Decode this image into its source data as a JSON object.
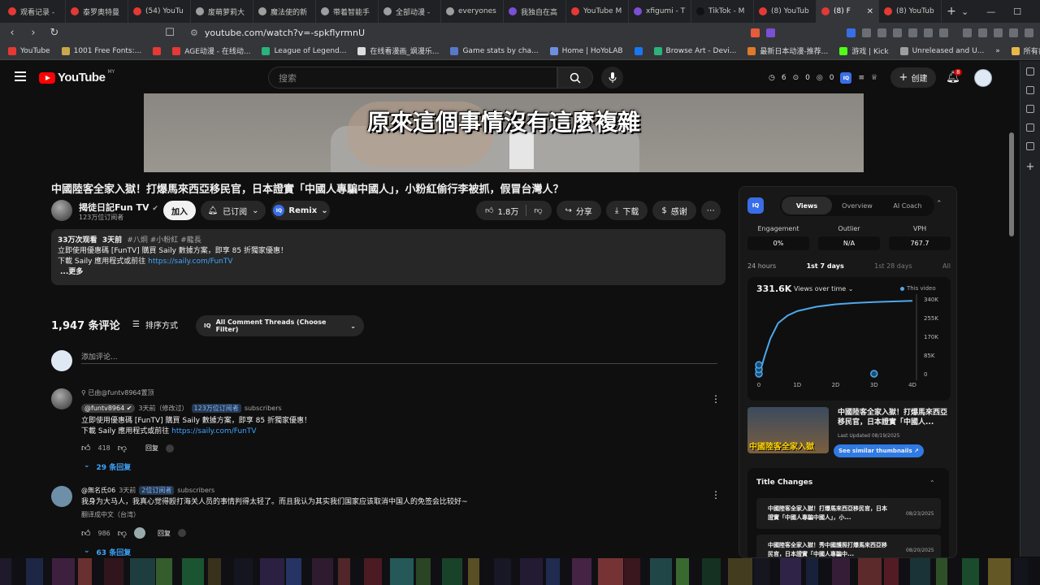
{
  "browser": {
    "tabs": [
      {
        "label": "观看记录 -",
        "color": "#e53935"
      },
      {
        "label": "泰罗奥特曼",
        "color": "#e53935"
      },
      {
        "label": "(54) YouTu",
        "color": "#e53935"
      },
      {
        "label": "废萌萝莉大",
        "color": "#9e9e9e"
      },
      {
        "label": "魔法使的新",
        "color": "#9e9e9e"
      },
      {
        "label": "带着智能手",
        "color": "#9e9e9e"
      },
      {
        "label": "全部动漫 -",
        "color": "#9e9e9e"
      },
      {
        "label": "everyones",
        "color": "#9e9e9e"
      },
      {
        "label": "我独自在高",
        "color": "#7b4fd6"
      },
      {
        "label": "YouTube M",
        "color": "#e53935"
      },
      {
        "label": "xfigumi - T",
        "color": "#7b4fd6"
      },
      {
        "label": "TikTok - M",
        "color": "#111111"
      },
      {
        "label": "(8) YouTub",
        "color": "#e53935"
      },
      {
        "label": "(8) F",
        "color": "#e53935"
      },
      {
        "label": "(8) YouTub",
        "color": "#e53935"
      }
    ],
    "active_tab_close": "✕",
    "new_tab": "+",
    "window_controls": [
      "⌄",
      "—",
      "☐",
      "✕"
    ],
    "url": "youtube.com/watch?v=-spkflyrmnU",
    "bookmarks": [
      {
        "label": "YouTube",
        "color": "#e53935"
      },
      {
        "label": "1001 Free Fonts:...",
        "color": "#c8a84a"
      },
      {
        "label": "",
        "color": "#e53935"
      },
      {
        "label": "AGE动漫 - 在线动...",
        "color": "#e53935"
      },
      {
        "label": "League of Legend...",
        "color": "#2bb37a"
      },
      {
        "label": "在线看漫画_飒漫乐...",
        "color": "#dddddd"
      },
      {
        "label": "Game stats by cha...",
        "color": "#5a78c9"
      },
      {
        "label": "Home | HoYoLAB",
        "color": "#6d8fe0"
      },
      {
        "label": "",
        "color": "#1877f2"
      },
      {
        "label": "Browse Art - Devi...",
        "color": "#2bb37a"
      },
      {
        "label": "最新日本动漫-推荐...",
        "color": "#e07a2b"
      },
      {
        "label": "游戏 | Kick",
        "color": "#53fc18"
      },
      {
        "label": "Unreleased and U...",
        "color": "#9e9e9e"
      }
    ],
    "bookmarks_more": "»",
    "all_bookmarks": "所有書籤"
  },
  "yt_header": {
    "logo_text": "YouTube",
    "logo_country": "MY",
    "search_placeholder": "搜索",
    "stats": [
      "6",
      "0",
      "0"
    ],
    "create_label": "创建",
    "notifications": "8"
  },
  "video": {
    "subtitle": "原來這個事情沒有這麼複雜",
    "title": "中國陸客全家入獄！打爆馬來西亞移民官，日本證實「中國人專騙中國人」，小粉紅偷行李被抓，假冒台灣人？",
    "channel": "揭徒日記Fun TV",
    "subscribers": "123万位订阅者",
    "join": "加入",
    "subscribed": "已订阅",
    "remix": "Remix",
    "likes": "1.8万",
    "share": "分享",
    "download": "下载",
    "thanks": "感谢"
  },
  "description": {
    "views": "33万次观看",
    "age": "3天前",
    "tags": "#八炯 #小粉紅 #龍長",
    "line1": "立即使用優惠碼 [FunTV] 購買 Saily 數據方案，即享 85 折獨家優惠！",
    "line2_prefix": "下載 Saily 應用程式或前往 ",
    "line2_link": "https://saily.com/FunTV",
    "more": "...更多"
  },
  "comments_header": {
    "count": "1,947 条评论",
    "sort": "排序方式",
    "filter": "All Comment Threads (Choose Filter)",
    "add_placeholder": "添加评论..."
  },
  "comments": [
    {
      "pinned_by": "已由@funtv8964置顶",
      "author": "@funtv8964",
      "time": "3天前（修改过）",
      "sub_count": "123万位订阅者",
      "sub_word": "subscribers",
      "line1": "立即使用優惠碼 [FunTV] 購買 Saily 數據方案，即享 85 折獨家優惠！",
      "line2_prefix": "下載 Saily 應用程式或前往 ",
      "line2_link": "https://saily.com/FunTV",
      "likes": "418",
      "reply": "回复",
      "replies": "29 条回复"
    },
    {
      "author": "@無名氏06",
      "time": "3天前",
      "sub_count": "2位订阅者",
      "sub_word": "subscribers",
      "line1": "我身为大马人，我真心觉得殴打海关人员的事情判得太轻了。而且我认为其实我们国家应该取消中国人的免签会比较好~",
      "translate": "翻译成中文（台湾）",
      "likes": "986",
      "reply": "回复",
      "replies": "63 条回复"
    }
  ],
  "panel": {
    "logo": "IQ",
    "tabs": [
      "Views",
      "Overview",
      "AI Coach"
    ],
    "metrics": [
      {
        "label": "Engagement",
        "value": "0%"
      },
      {
        "label": "Outlier",
        "value": "N/A"
      },
      {
        "label": "VPH",
        "value": "767.7"
      }
    ],
    "time_tabs": [
      "24 hours",
      "1st 7 days",
      "1st 28 days",
      "All"
    ],
    "total_views": "331.6K",
    "views_select": "Views over time",
    "legend": "This video",
    "thumb_overlay": "中國陸客全家入獄",
    "thumb_title": "中國陸客全家入獄！打爆馬來西亞移民官，日本證實「中國人...",
    "last_updated": "Last Updated 08/19/2025",
    "similar_btn": "See similar thumbnails ↗",
    "title_changes_head": "Title Changes",
    "title_changes": [
      {
        "title": "中國陸客全家入獄！打爆馬來西亞移民官，日本證實「中國人專騙中國人」，小...",
        "date": "08/23/2025"
      },
      {
        "title": "中國陸客全家入獄！秀中國護照打爆馬來西亞移民官，日本證實「中國人專騙中...",
        "date": "08/20/2025"
      }
    ]
  },
  "chart_data": {
    "type": "line",
    "x_ticks": [
      "0",
      "1D",
      "2D",
      "3D",
      "4D"
    ],
    "y_ticks": [
      "0",
      "85K",
      "170K",
      "255K",
      "340K"
    ],
    "ylim": [
      0,
      340000
    ],
    "xlim": [
      0,
      4
    ],
    "series": [
      {
        "name": "This video",
        "x": [
          0,
          0.05,
          0.15,
          0.3,
          0.5,
          0.75,
          1.0,
          1.5,
          2.0,
          2.5,
          3.0,
          3.5,
          4.0
        ],
        "y": [
          0,
          20000,
          80000,
          160000,
          230000,
          265000,
          285000,
          305000,
          316000,
          322000,
          326000,
          329000,
          331600
        ]
      }
    ],
    "markers": [
      {
        "x": 0,
        "y": 0
      },
      {
        "x": 0,
        "y": 20000
      },
      {
        "x": 0,
        "y": 40000
      },
      {
        "x": 3,
        "y": 0
      }
    ],
    "color": "#4fa8ea"
  }
}
